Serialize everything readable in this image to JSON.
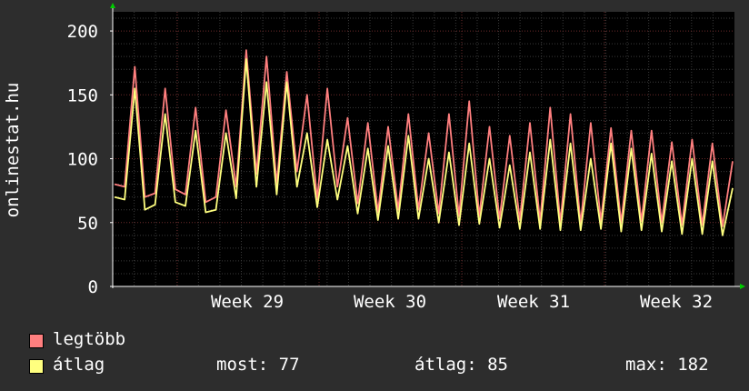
{
  "chart_data": {
    "type": "line",
    "ylabel": "onlinestat.hu",
    "ylim": [
      0,
      215
    ],
    "yticks": [
      0,
      50,
      100,
      150,
      200
    ],
    "x_labels": [
      "Week 29",
      "Week 30",
      "Week 31",
      "Week 32"
    ],
    "grid": true,
    "series": [
      {
        "name": "legtöbb",
        "color": "#ff7f7f",
        "values": [
          80,
          78,
          172,
          70,
          73,
          155,
          76,
          72,
          140,
          66,
          70,
          138,
          78,
          185,
          88,
          180,
          80,
          168,
          90,
          150,
          68,
          155,
          78,
          132,
          65,
          128,
          58,
          125,
          60,
          135,
          60,
          120,
          57,
          135,
          55,
          145,
          55,
          125,
          53,
          118,
          52,
          128,
          51,
          140,
          50,
          135,
          49,
          128,
          51,
          124,
          50,
          122,
          51,
          122,
          50,
          113,
          48,
          115,
          48,
          112,
          47,
          98
        ]
      },
      {
        "name": "átlag",
        "color": "#ffff7f",
        "values": [
          70,
          68,
          155,
          60,
          64,
          135,
          66,
          63,
          122,
          58,
          60,
          120,
          69,
          178,
          78,
          160,
          72,
          160,
          78,
          120,
          62,
          115,
          68,
          110,
          57,
          108,
          52,
          110,
          53,
          118,
          53,
          100,
          50,
          105,
          48,
          112,
          49,
          100,
          46,
          95,
          45,
          105,
          45,
          115,
          44,
          112,
          44,
          100,
          45,
          112,
          43,
          108,
          44,
          104,
          43,
          98,
          41,
          100,
          41,
          98,
          40,
          77
        ]
      }
    ],
    "legend": {
      "items": [
        "legtöbb",
        "átlag"
      ],
      "stats": {
        "most_label": "most:",
        "most_value": "77",
        "atlag_label": "átlag:",
        "atlag_value": "85",
        "max_label": "max:",
        "max_value": "182"
      }
    }
  }
}
